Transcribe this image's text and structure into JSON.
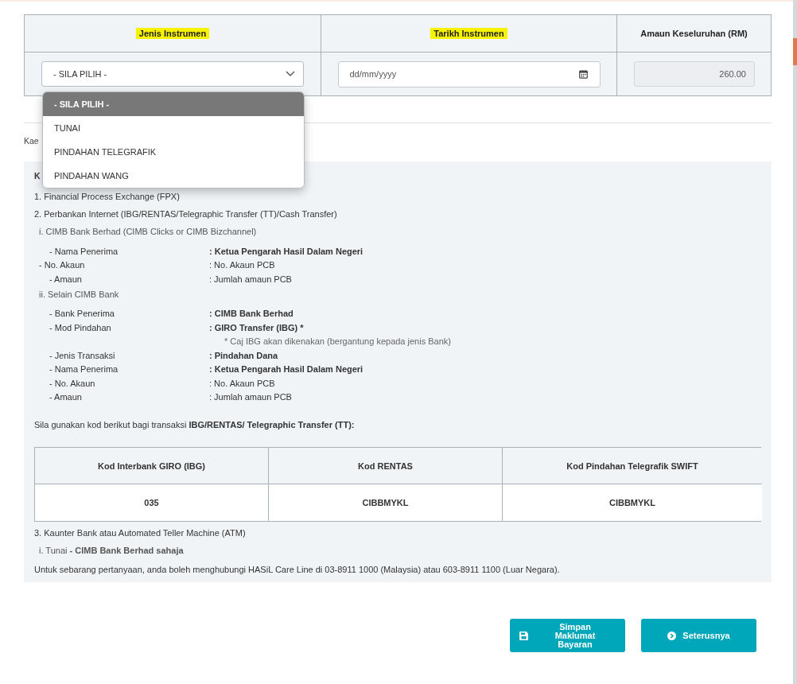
{
  "instrument_table": {
    "columns": [
      {
        "label": "Jenis Instrumen",
        "highlighted": true
      },
      {
        "label": "Tarikh Instrumen",
        "highlighted": true
      },
      {
        "label": "Amaun Keseluruhan (RM)",
        "highlighted": false
      }
    ],
    "select": {
      "value": "- SILA PILIH -"
    },
    "date": {
      "placeholder": "dd/mm/yyyy"
    },
    "amount": {
      "value": "260.00",
      "disabled": true
    }
  },
  "dropdown": {
    "options": [
      {
        "label": "- SILA PILIH -",
        "selected": true
      },
      {
        "label": "TUNAI",
        "selected": false
      },
      {
        "label": "PINDAHAN TELEGRAFIK",
        "selected": false
      },
      {
        "label": "PINDAHAN WANG",
        "selected": false
      }
    ]
  },
  "method_label": "Kae",
  "panel": {
    "heading": "K",
    "lines": [
      {
        "kind": "item",
        "text": "1. Financial Process Exchange (FPX)"
      },
      {
        "kind": "item",
        "text": "2. Perbankan Internet (IBG/RENTAS/Telegraphic Transfer (TT)/Cash Transfer)"
      },
      {
        "kind": "sub",
        "text": "i. CIMB Bank Berhad (CIMB Clicks or CIMB Bizchannel)"
      },
      {
        "kind": "field",
        "label": "- Nama Penerima",
        "value": ": Ketua Pengarah Hasil Dalam Negeri",
        "bold": true
      },
      {
        "kind": "field_flush",
        "label": "- No. Akaun",
        "value": ": No. Akaun PCB",
        "bold": false
      },
      {
        "kind": "field",
        "label": "- Amaun",
        "value": ": Jumlah amaun PCB",
        "bold": false
      },
      {
        "kind": "sub",
        "text": "ii. Selain CIMB Bank"
      },
      {
        "kind": "field",
        "label": "- Bank Penerima",
        "value": ": CIMB Bank Berhad",
        "bold": true
      },
      {
        "kind": "field",
        "label": "- Mod Pindahan",
        "value": ": GIRO Transfer (IBG) *",
        "bold": true
      },
      {
        "kind": "note",
        "text": "* Caj IBG akan dikenakan (bergantung kepada jenis Bank)"
      },
      {
        "kind": "field",
        "label": "- Jenis Transaksi",
        "value": ": Pindahan Dana",
        "bold": true
      },
      {
        "kind": "field",
        "label": "- Nama Penerima",
        "value": ": Ketua Pengarah Hasil Dalam Negeri",
        "bold": true
      },
      {
        "kind": "field",
        "label": "- No. Akaun",
        "value": ": No. Akaun PCB",
        "bold": false
      },
      {
        "kind": "field",
        "label": "- Amaun",
        "value": ": Jumlah amaun PCB",
        "bold": false
      },
      {
        "kind": "sentence",
        "text": "Sila gunakan kod berikut bagi transaksi **IBG/RENTAS/ Telegraphic Transfer (TT):**"
      },
      {
        "kind": "codes",
        "columns": [
          "Kod Interbank GIRO (IBG)",
          "Kod RENTAS",
          "Kod Pindahan Telegrafik SWIFT"
        ],
        "values": [
          "035",
          "CIBBMYKL",
          "CIBBMYKL"
        ]
      },
      {
        "kind": "item",
        "text": "3. Kaunter Bank atau Automated Teller Machine (ATM)"
      },
      {
        "kind": "sub",
        "text": "i. Tunai  **- CIMB Bank Berhad sahaja**"
      },
      {
        "kind": "sentence",
        "text": "Untuk sebarang pertanyaan, anda boleh menghubungi HASiL Care Line di 03-8911 1000 (Malaysia) atau 603-8911 1100 (Luar Negara)."
      }
    ]
  },
  "buttons": [
    {
      "kind": "save",
      "label": "Simpan Maklumat Bayaran"
    },
    {
      "kind": "next",
      "label": "Seterusnya"
    }
  ]
}
